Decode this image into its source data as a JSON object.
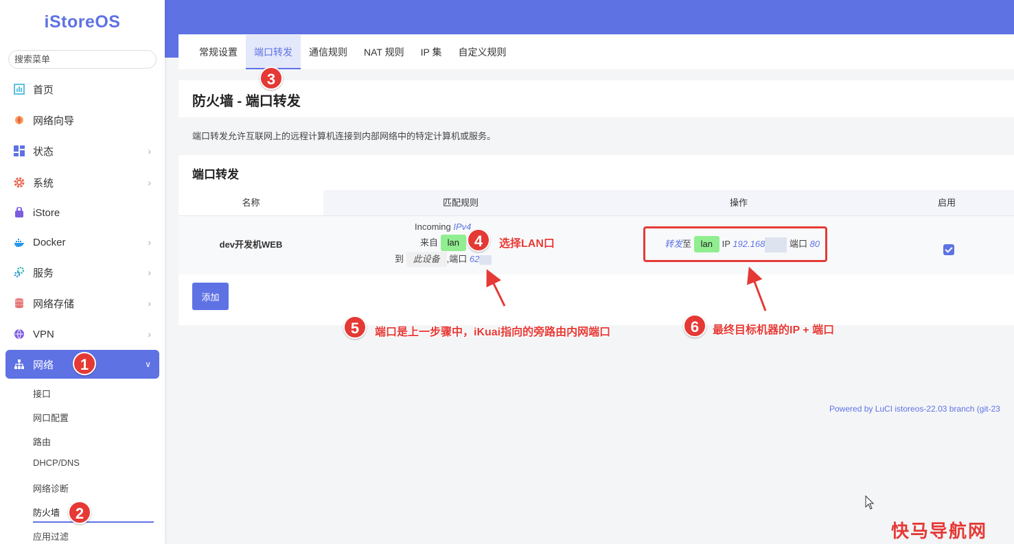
{
  "logo": "iStoreOS",
  "search": {
    "placeholder": "搜索菜单"
  },
  "menu": [
    {
      "label": "首页",
      "icon": "dashboard-icon"
    },
    {
      "label": "网络向导",
      "icon": "wizard-icon"
    },
    {
      "label": "状态",
      "icon": "status-icon"
    },
    {
      "label": "系统",
      "icon": "gear-icon"
    },
    {
      "label": "iStore",
      "icon": "store-icon"
    },
    {
      "label": "Docker",
      "icon": "docker-icon"
    },
    {
      "label": "服务",
      "icon": "services-icon"
    },
    {
      "label": "网络存储",
      "icon": "storage-icon"
    },
    {
      "label": "VPN",
      "icon": "vpn-icon"
    },
    {
      "label": "网络",
      "icon": "network-icon"
    }
  ],
  "submenu": [
    "接口",
    "网口配置",
    "路由",
    "DHCP/DNS",
    "网络诊断",
    "防火墙",
    "应用过滤"
  ],
  "tabs": [
    "常规设置",
    "端口转发",
    "通信规则",
    "NAT 规则",
    "IP 集",
    "自定义规则"
  ],
  "page": {
    "title": "防火墙 - 端口转发",
    "description": "端口转发允许互联网上的远程计算机连接到内部网络中的特定计算机或服务。",
    "section_title": "端口转发"
  },
  "table": {
    "headers": [
      "名称",
      "匹配规则",
      "操作",
      "启用"
    ],
    "row": {
      "name": "dev开发机WEB",
      "match": {
        "incoming": "Incoming",
        "ipv4": "IPv4",
        "from": "来自",
        "zone": "lan",
        "to": "到",
        "device": "此设备",
        "port_label": ",端口",
        "port": "62"
      },
      "action": {
        "forward": "转发",
        "to": "至",
        "zone": "lan",
        "ip_label": "IP",
        "ip": "192.168",
        "port_label": "端口",
        "port": "80"
      },
      "enabled": true
    }
  },
  "add_button": "添加",
  "footer": "Powered by LuCI istoreos-22.03 branch (git-23",
  "annotations": {
    "m1": "1",
    "m2": "2",
    "m3": "3",
    "m4": "4",
    "m5": "5",
    "m6": "6",
    "t4": "选择LAN口",
    "t5": "端口是上一步骤中，iKuai指向的旁路由内网端口",
    "t6": "最终目标机器的IP + 端口"
  },
  "watermark": "快马导航网",
  "colors": {
    "accent": "#5e72e4",
    "annotation": "#e53935",
    "zone": "#90ee90"
  }
}
